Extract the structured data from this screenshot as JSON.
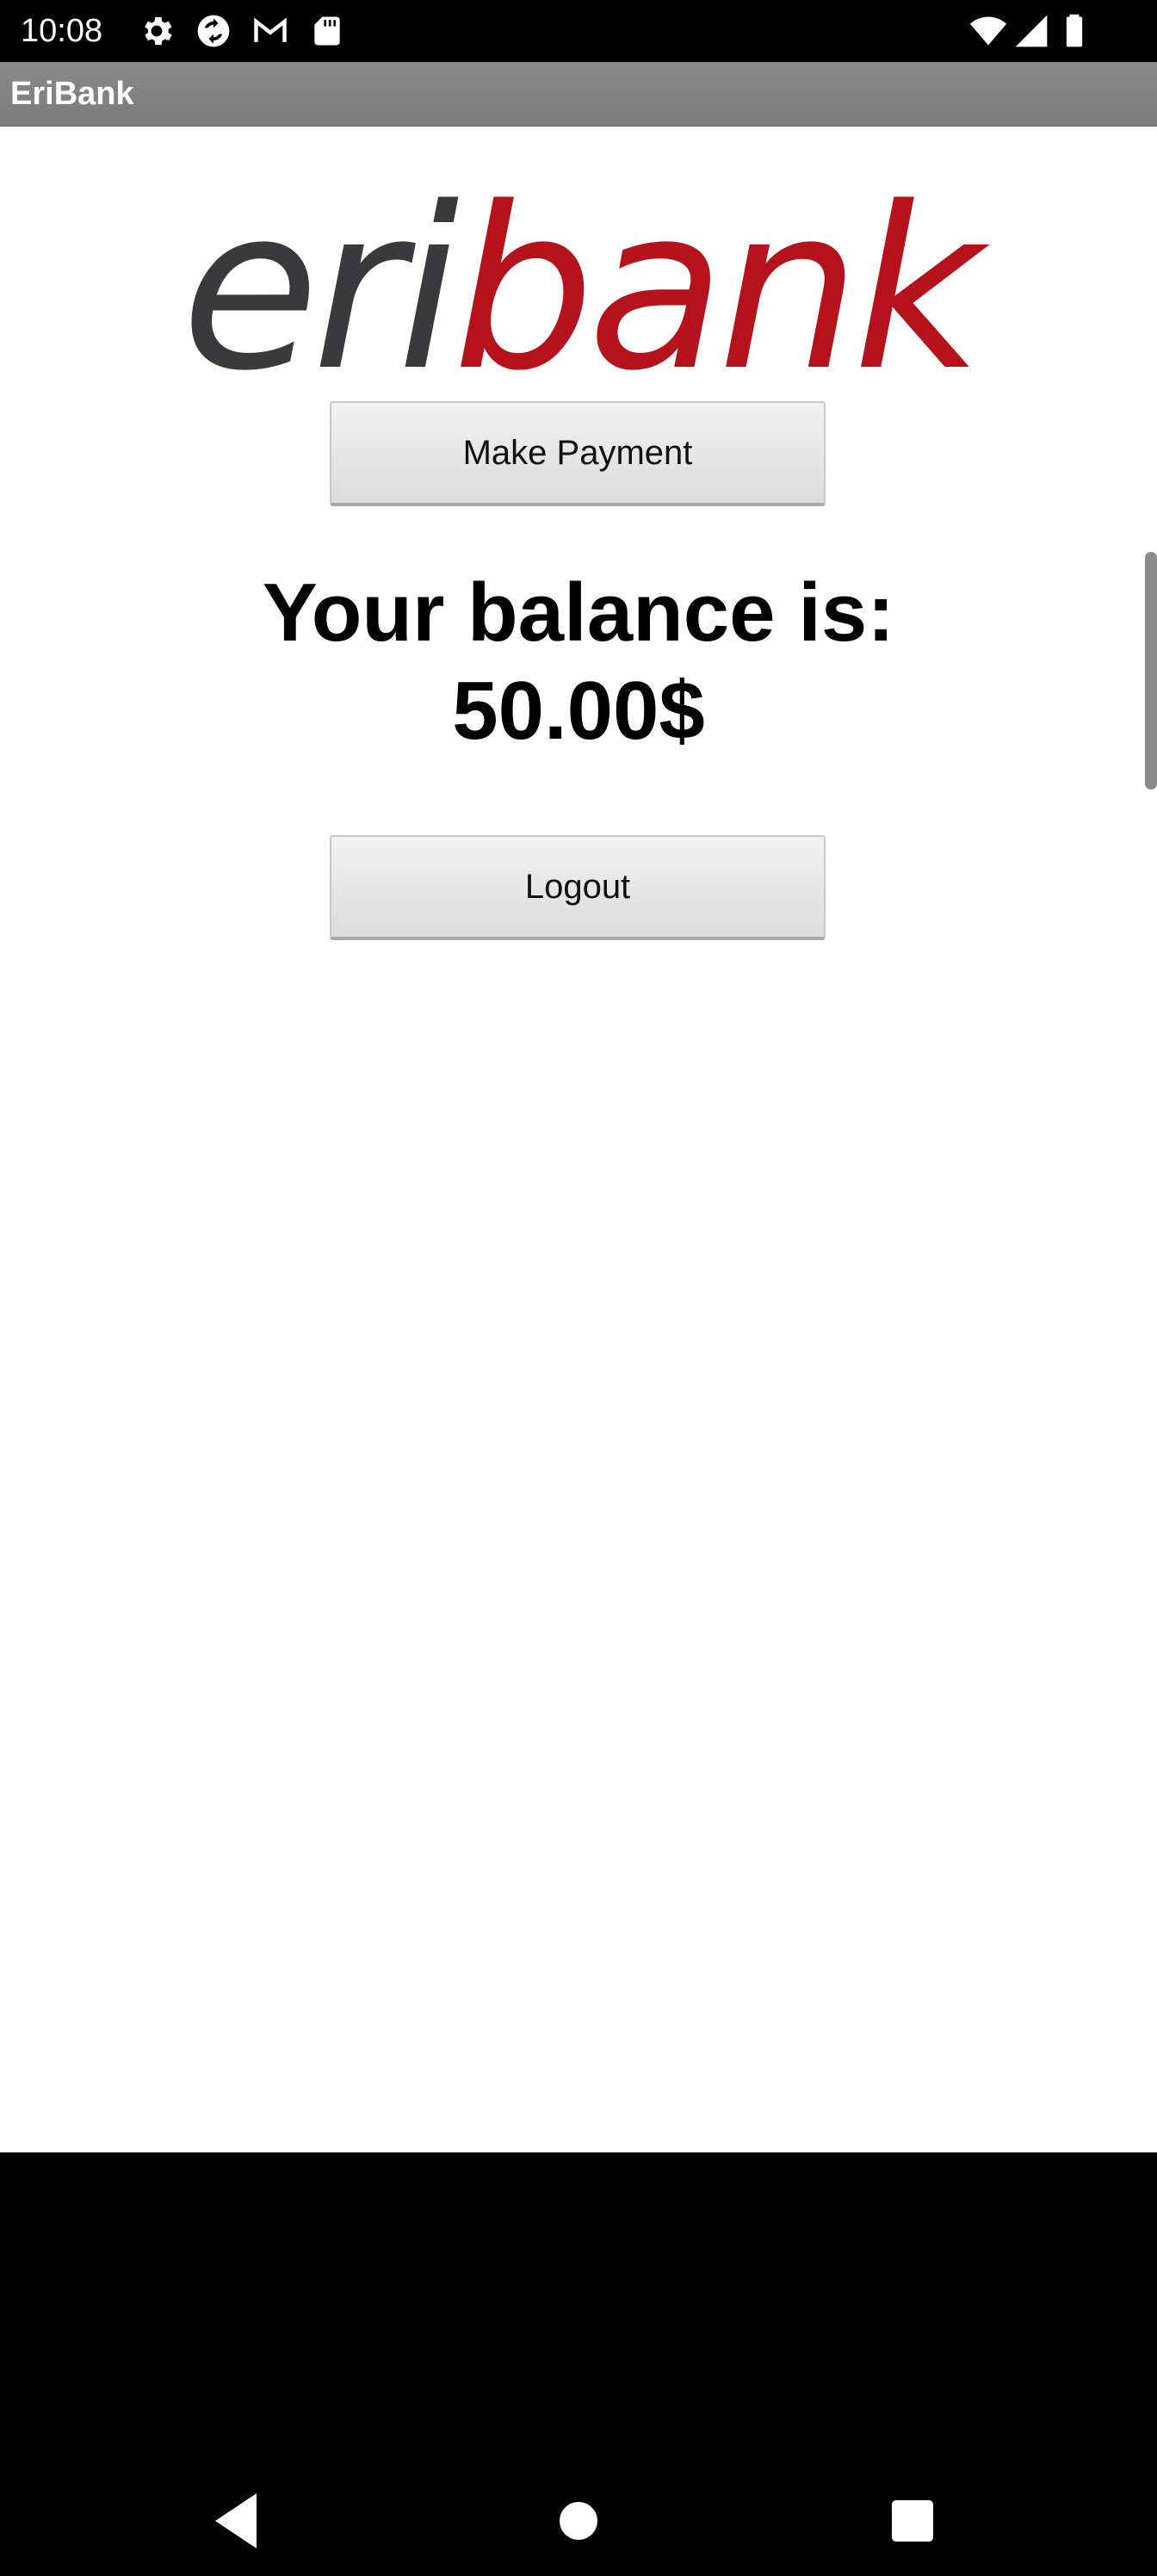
{
  "status_bar": {
    "time": "10:08",
    "icons_left": [
      "settings-icon",
      "sync-icon",
      "gmail-icon",
      "sd-card-icon"
    ],
    "icons_right": [
      "wifi-icon",
      "cellular-signal-icon",
      "battery-icon"
    ]
  },
  "action_bar": {
    "title": "EriBank"
  },
  "logo": {
    "part_a": "eri",
    "part_b": "bank",
    "colors": {
      "part_a": "#3a3a3c",
      "part_b": "#b5121b"
    }
  },
  "main": {
    "make_payment_label": "Make Payment",
    "balance_line1": "Your balance is:",
    "balance_line2": "50.00$",
    "logout_label": "Logout"
  },
  "nav_bar": {
    "buttons": [
      "back-icon",
      "home-icon",
      "recents-icon"
    ]
  }
}
